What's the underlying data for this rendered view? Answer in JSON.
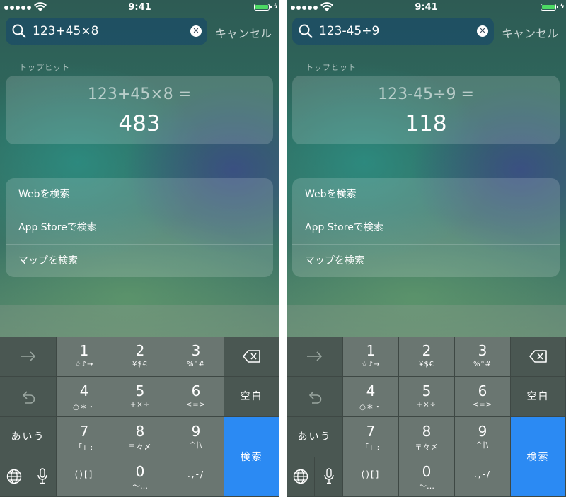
{
  "status_bar": {
    "time": "9:41"
  },
  "screens": [
    {
      "query": "123+45×8",
      "cancel_label": "キャンセル",
      "section_label": "トップヒット",
      "expression": "123+45×8 =",
      "result": "483",
      "actions": [
        "Webを検索",
        "App Storeで検索",
        "マップを検索"
      ]
    },
    {
      "query": "123-45÷9",
      "cancel_label": "キャンセル",
      "section_label": "トップヒット",
      "expression": "123-45÷9 =",
      "result": "118",
      "actions": [
        "Webを検索",
        "App Storeで検索",
        "マップを検索"
      ]
    }
  ],
  "keyboard": {
    "keys": {
      "k1": {
        "main": "1",
        "sub": "☆♪→"
      },
      "k2": {
        "main": "2",
        "sub": "¥$€"
      },
      "k3": {
        "main": "3",
        "sub": "%°#"
      },
      "k4": {
        "main": "4",
        "sub": "○＊・"
      },
      "k5": {
        "main": "5",
        "sub": "+×÷"
      },
      "k6": {
        "main": "6",
        "sub": "<=>"
      },
      "k7": {
        "main": "7",
        "sub": "「」:"
      },
      "k8": {
        "main": "8",
        "sub": "〒々〆"
      },
      "k9": {
        "main": "9",
        "sub": "^|\\"
      },
      "k0": {
        "main": "0",
        "sub": "〜…"
      },
      "brackets": "()[]",
      "punct": ".,-/"
    },
    "space_label": "空白",
    "kana_label": "あいう",
    "search_label": "検索",
    "icons": [
      "arrow-right-icon",
      "undo-icon",
      "globe-icon",
      "microphone-icon",
      "delete-backspace-icon"
    ],
    "accent_color": "#2b8af3"
  }
}
